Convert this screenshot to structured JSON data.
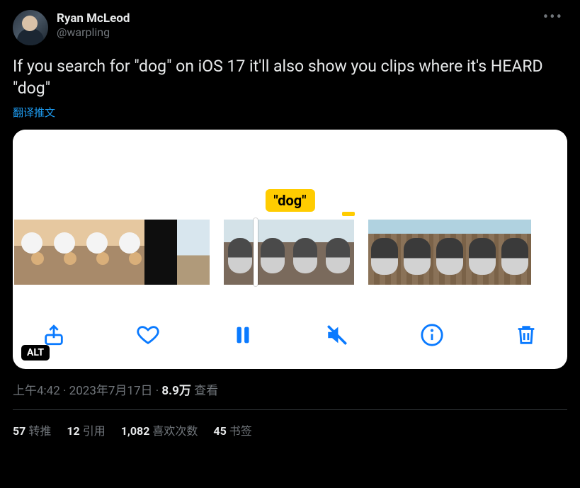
{
  "author": {
    "display_name": "Ryan McLeod",
    "handle": "@warpling"
  },
  "tweet_text": "If you search for \"dog\" on iOS 17 it'll also show you clips where it's HEARD \"dog\"",
  "translate_label": "翻译推文",
  "media": {
    "highlight_tag": "\"dog\"",
    "alt_badge": "ALT"
  },
  "meta": {
    "time": "上午4:42",
    "date": "2023年7月17日",
    "separator": " · ",
    "views_number": "8.9万",
    "views_label": " 查看"
  },
  "stats": {
    "retweets_num": "57",
    "retweets_label": "转推",
    "quotes_num": "12",
    "quotes_label": "引用",
    "likes_num": "1,082",
    "likes_label": "喜欢次数",
    "bookmarks_num": "45",
    "bookmarks_label": "书签"
  }
}
